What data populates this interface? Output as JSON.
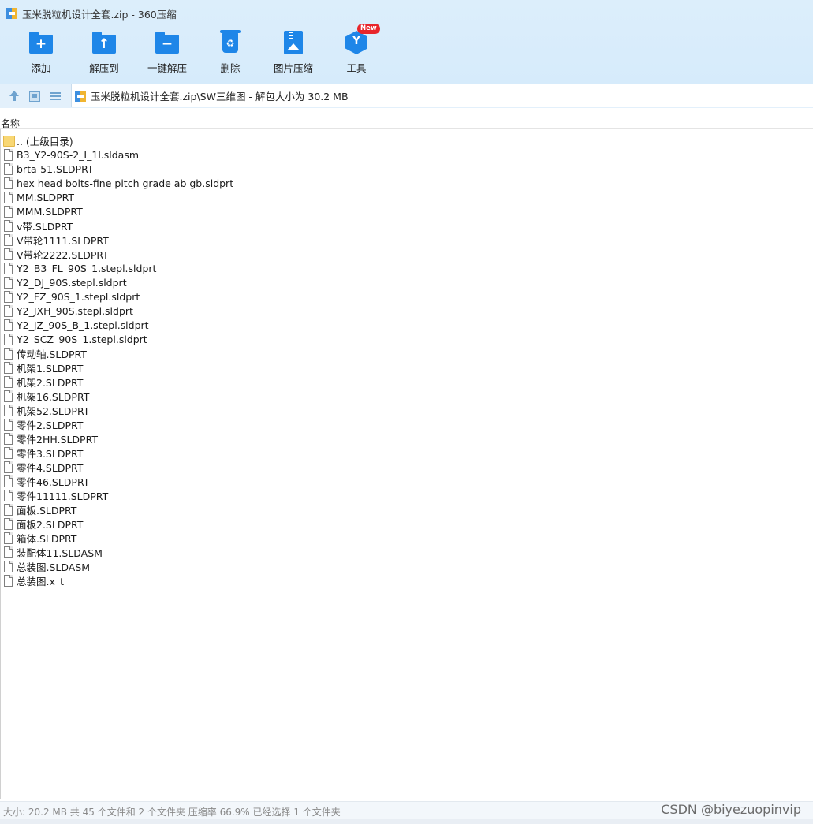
{
  "window": {
    "title": "玉米脱粒机设计全套.zip - 360压缩"
  },
  "toolbar": {
    "buttons": [
      {
        "label": "添加",
        "icon": "add-folder-icon"
      },
      {
        "label": "解压到",
        "icon": "extract-to-icon"
      },
      {
        "label": "一键解压",
        "icon": "one-click-extract-icon"
      },
      {
        "label": "删除",
        "icon": "recycle-bin-icon"
      },
      {
        "label": "图片压缩",
        "icon": "image-compress-icon"
      },
      {
        "label": "工具",
        "icon": "tools-icon",
        "badge": "New"
      }
    ]
  },
  "navigation": {
    "path": "玉米脱粒机设计全套.zip\\SW三维图 - 解包大小为 30.2 MB"
  },
  "list": {
    "column_name": "名称",
    "files": [
      {
        "name": ".. (上级目录)",
        "type": "folder"
      },
      {
        "name": "B3_Y2-90S-2_I_1l.sldasm",
        "type": "file"
      },
      {
        "name": "brta-51.SLDPRT",
        "type": "file"
      },
      {
        "name": "hex head bolts-fine pitch grade ab gb.sldprt",
        "type": "file"
      },
      {
        "name": "MM.SLDPRT",
        "type": "file"
      },
      {
        "name": "MMM.SLDPRT",
        "type": "file"
      },
      {
        "name": "v带.SLDPRT",
        "type": "file"
      },
      {
        "name": "V带轮1111.SLDPRT",
        "type": "file"
      },
      {
        "name": "V带轮2222.SLDPRT",
        "type": "file"
      },
      {
        "name": "Y2_B3_FL_90S_1.stepl.sldprt",
        "type": "file"
      },
      {
        "name": "Y2_DJ_90S.stepl.sldprt",
        "type": "file"
      },
      {
        "name": "Y2_FZ_90S_1.stepl.sldprt",
        "type": "file"
      },
      {
        "name": "Y2_JXH_90S.stepl.sldprt",
        "type": "file"
      },
      {
        "name": "Y2_JZ_90S_B_1.stepl.sldprt",
        "type": "file"
      },
      {
        "name": "Y2_SCZ_90S_1.stepl.sldprt",
        "type": "file"
      },
      {
        "name": "传动轴.SLDPRT",
        "type": "file"
      },
      {
        "name": "机架1.SLDPRT",
        "type": "file"
      },
      {
        "name": "机架2.SLDPRT",
        "type": "file"
      },
      {
        "name": "机架16.SLDPRT",
        "type": "file"
      },
      {
        "name": "机架52.SLDPRT",
        "type": "file"
      },
      {
        "name": "零件2.SLDPRT",
        "type": "file"
      },
      {
        "name": "零件2HH.SLDPRT",
        "type": "file"
      },
      {
        "name": "零件3.SLDPRT",
        "type": "file"
      },
      {
        "name": "零件4.SLDPRT",
        "type": "file"
      },
      {
        "name": "零件46.SLDPRT",
        "type": "file"
      },
      {
        "name": "零件11111.SLDPRT",
        "type": "file"
      },
      {
        "name": "面板.SLDPRT",
        "type": "file"
      },
      {
        "name": "面板2.SLDPRT",
        "type": "file"
      },
      {
        "name": "箱体.SLDPRT",
        "type": "file"
      },
      {
        "name": "装配体11.SLDASM",
        "type": "file"
      },
      {
        "name": "总装图.SLDASM",
        "type": "file"
      },
      {
        "name": "总装图.x_t",
        "type": "file"
      }
    ]
  },
  "statusbar": {
    "text": "大小: 20.2 MB 共 45 个文件和 2 个文件夹 压缩率 66.9% 已经选择 1 个文件夹"
  },
  "watermark": "CSDN @biyezuopinvip",
  "colors": {
    "accent": "#1e86e8",
    "titlebar": "#dceefb",
    "badge": "#e8262b"
  }
}
